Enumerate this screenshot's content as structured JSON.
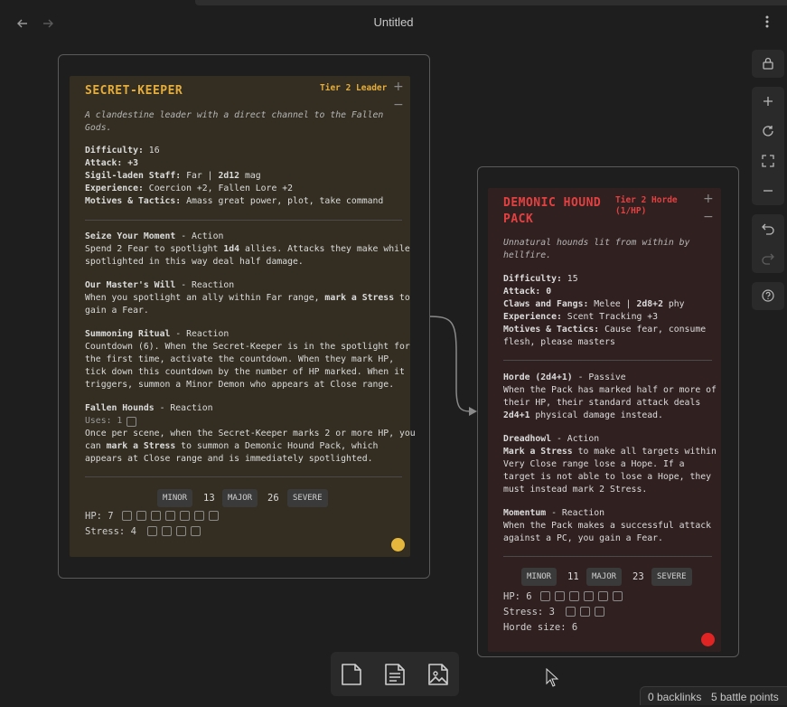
{
  "window": {
    "title": "Untitled",
    "back_icon": "arrow-left-icon",
    "forward_icon": "arrow-right-icon",
    "more_icon": "more-vertical-icon"
  },
  "canvas": {
    "connector_color": "#8a8a8a"
  },
  "cards": {
    "keeper": {
      "name": "SECRET-KEEPER",
      "tier": "Tier 2 Leader",
      "accent": "#e5ad3c",
      "description": [
        "A clandestine leader with a direct channel to the Fallen",
        "Gods."
      ],
      "stats": {
        "difficulty_label": "Difficulty:",
        "difficulty": "16",
        "attack_label": "Attack:",
        "attack": "+3",
        "weapon_label": "Sigil-laden Staff:",
        "weapon_range": "Far |",
        "weapon_damage": "2d12",
        "weapon_type": "mag",
        "experience_label": "Experience:",
        "experience": "Coercion +2, Fallen Lore +2",
        "motives_label": "Motives & Tactics:",
        "motives": "Amass great power, plot, take command"
      },
      "features": [
        {
          "name": "Seize Your Moment",
          "type": "- Action",
          "lines": [
            "Spend 2 Fear to spotlight ",
            "1d4",
            " allies. Attacks they make while",
            "spotlighted in this way deal half damage."
          ]
        },
        {
          "name": "Our Master's Will",
          "type": "- Reaction",
          "lines": [
            "When you spotlight an ally within Far range, ",
            "mark a Stress",
            " to",
            "gain a Fear."
          ]
        },
        {
          "name": "Summoning Ritual",
          "type": "- Reaction",
          "lines": [
            "Countdown (6). When the Secret-Keeper is in the spotlight for",
            "the first time, activate the countdown. When they mark HP,",
            "tick down this countdown by the number of HP marked. When it",
            "triggers, summon a Minor Demon who appears at Close range."
          ]
        },
        {
          "name": "Fallen Hounds",
          "type": "- Reaction",
          "uses": "Uses: 1",
          "lines": [
            "Once per scene, when the Secret-Keeper marks 2 or more HP, you",
            "can ",
            "mark a Stress",
            " to summon a Demonic Hound Pack, which",
            "appears at Close range and is immediately spotlighted."
          ]
        }
      ],
      "thresholds": {
        "minor": "MINOR",
        "minor_val": "13",
        "major": "MAJOR",
        "major_val": "26",
        "severe": "SEVERE"
      },
      "hp_label": "HP: 7",
      "hp_count": 7,
      "stress_label": "Stress: 4",
      "stress_count": 4
    },
    "hound": {
      "name_line1": "DEMONIC HOUND",
      "name_line2": "PACK",
      "tier_line1": "Tier 2 Horde",
      "tier_line2": "(1/HP)",
      "accent": "#e34141",
      "description": [
        "Unnatural hounds lit from within by",
        "hellfire."
      ],
      "stats": {
        "difficulty_label": "Difficulty:",
        "difficulty": "15",
        "attack_label": "Attack:",
        "attack": "0",
        "weapon_label": "Claws and Fangs:",
        "weapon_range": "Melee |",
        "weapon_damage": "2d8+2",
        "weapon_type": "phy",
        "experience_label": "Experience:",
        "experience": "Scent Tracking +3",
        "motives_label": "Motives & Tactics:",
        "motives_line1": "Cause fear, consume",
        "motives_line2": "flesh, please masters"
      },
      "features": [
        {
          "name": "Horde (2d4+1)",
          "type": "- Passive",
          "lines": [
            "When the Pack has marked half or more of",
            "their HP, their standard attack deals",
            "2d4+1",
            " physical damage instead."
          ]
        },
        {
          "name": "Dreadhowl",
          "type": "- Action",
          "lines": [
            "Mark a Stress",
            " to make all targets within",
            "Very Close range lose a Hope. If a",
            "target is not able to lose a Hope, they",
            "must instead mark 2 Stress."
          ]
        },
        {
          "name": "Momentum",
          "type": "- Reaction",
          "lines": [
            "When the Pack makes a successful attack",
            "against a PC, you gain a Fear."
          ]
        }
      ],
      "thresholds": {
        "minor": "MINOR",
        "minor_val": "11",
        "major": "MAJOR",
        "major_val": "23",
        "severe": "SEVERE"
      },
      "hp_label": "HP: 6",
      "hp_count": 6,
      "stress_label": "Stress: 3",
      "stress_count": 3,
      "horde_label": "Horde size: 6"
    }
  },
  "toolbar": {
    "items": [
      "lock-icon",
      "zoom-in-icon",
      "reset-zoom-icon",
      "fit-screen-icon",
      "zoom-out-icon",
      "undo-icon",
      "redo-icon",
      "help-icon"
    ]
  },
  "bottom_toolbar": {
    "items": [
      "new-card-icon",
      "new-note-icon",
      "new-media-icon"
    ]
  },
  "status": {
    "backlinks": "0 backlinks",
    "battle_points": "5 battle points"
  }
}
